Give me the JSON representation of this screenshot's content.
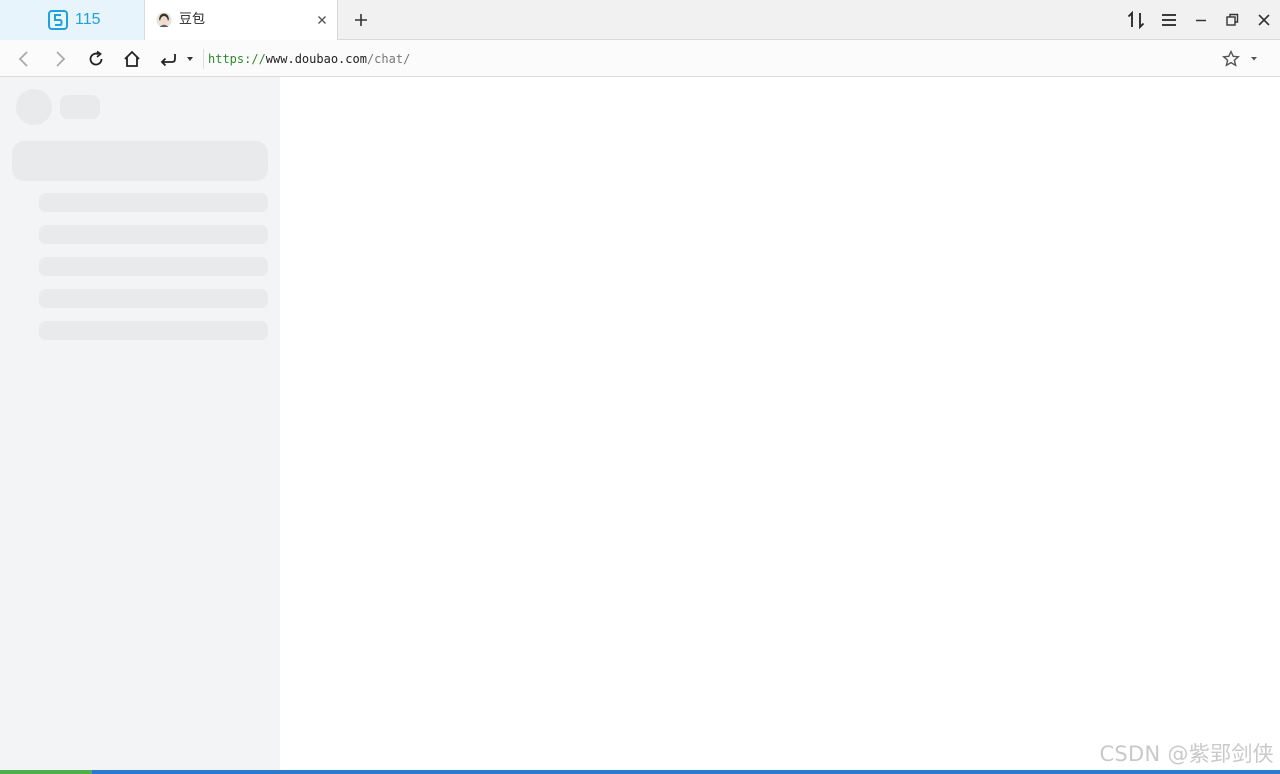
{
  "tabs": [
    {
      "label": "115",
      "icon": "115-logo-icon",
      "color": "#1ea2dc"
    },
    {
      "label": "豆包",
      "icon": "doubao-avatar-icon",
      "active": true
    }
  ],
  "toolbar": {
    "url_scheme": "https://",
    "url_host": "www.doubao.com",
    "url_path": "/chat/",
    "buttons": [
      "back-icon",
      "forward-icon",
      "reload-icon",
      "home-icon",
      "undo-close-icon",
      "dropdown-icon",
      "star-icon"
    ]
  },
  "window_controls": [
    "sync-icon",
    "menu-icon",
    "minimize-icon",
    "restore-icon",
    "close-icon"
  ],
  "sidebar": {
    "state": "loading-skeleton",
    "skeleton_rows": 5
  },
  "watermark": "CSDN @紫郢剑侠",
  "colors": {
    "accent_115": "#1ea2dc",
    "sidebar_bg": "#f3f4f6",
    "skeleton": "#e9eaec",
    "url_scheme": "#2e8b2e"
  }
}
